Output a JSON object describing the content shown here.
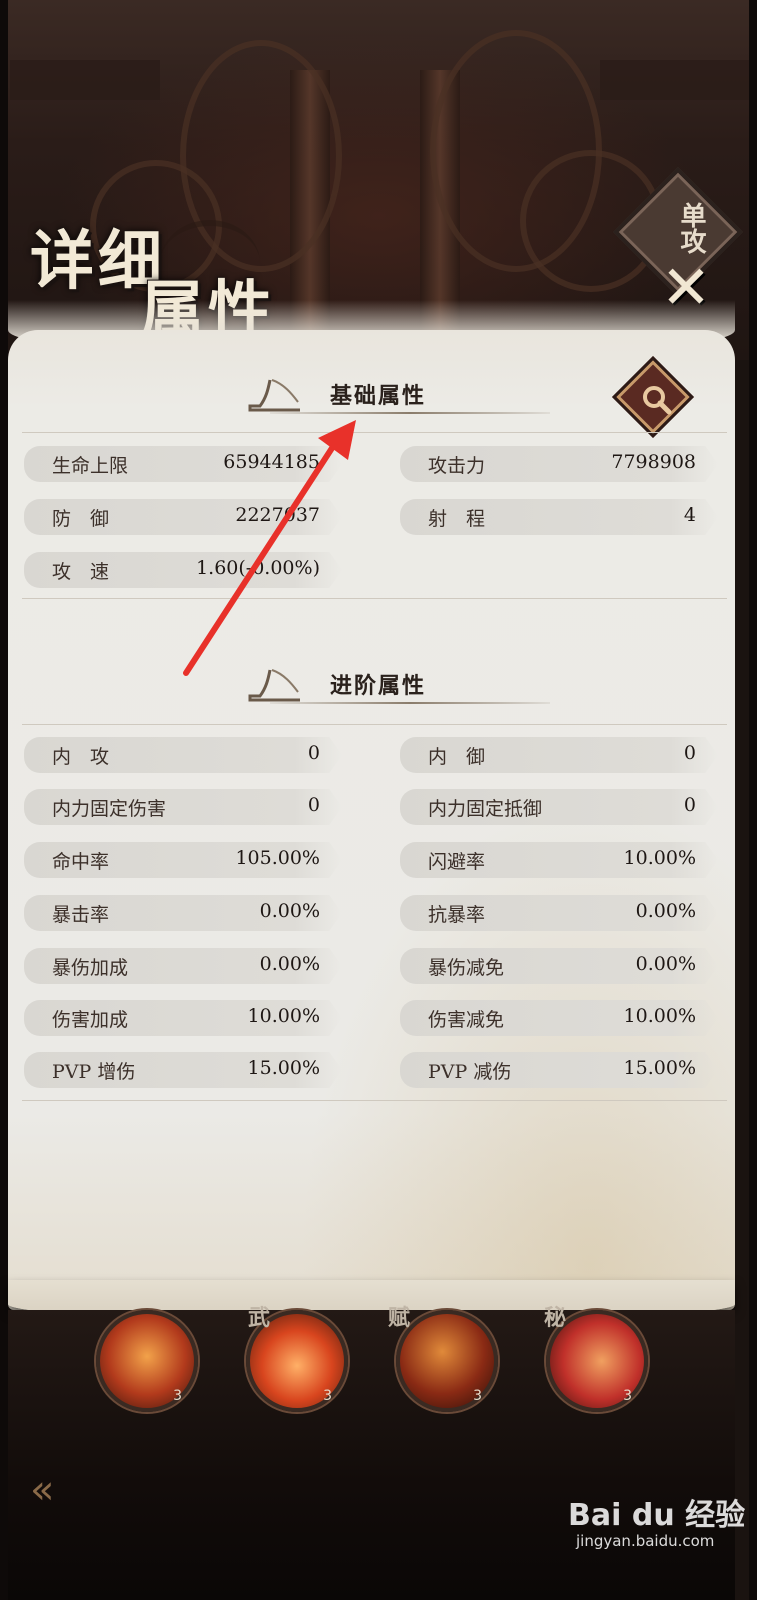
{
  "title": {
    "line1": "详细",
    "line2": "属性"
  },
  "mode_badge": "单攻",
  "close_icon": "close-icon",
  "basic_section": {
    "title": "基础属性",
    "stats": [
      {
        "label": "生命上限",
        "value": "65944185"
      },
      {
        "label": "攻击力",
        "value": "7798908"
      },
      {
        "label": "防　御",
        "value": "2227037"
      },
      {
        "label": "射　程",
        "value": "4"
      },
      {
        "label": "攻　速",
        "value": "1.60(-0.00%)"
      }
    ]
  },
  "advanced_section": {
    "title": "进阶属性",
    "stats": [
      {
        "label": "内　攻",
        "value": "0"
      },
      {
        "label": "内　御",
        "value": "0"
      },
      {
        "label": "内力固定伤害",
        "value": "0"
      },
      {
        "label": "内力固定抵御",
        "value": "0"
      },
      {
        "label": "命中率",
        "value": "105.00%"
      },
      {
        "label": "闪避率",
        "value": "10.00%"
      },
      {
        "label": "暴击率",
        "value": "0.00%"
      },
      {
        "label": "抗暴率",
        "value": "0.00%"
      },
      {
        "label": "暴伤加成",
        "value": "0.00%"
      },
      {
        "label": "暴伤减免",
        "value": "0.00%"
      },
      {
        "label": "伤害加成",
        "value": "10.00%"
      },
      {
        "label": "伤害减免",
        "value": "10.00%"
      },
      {
        "label": "PVP 增伤",
        "value": "15.00%"
      },
      {
        "label": "PVP 减伤",
        "value": "15.00%"
      }
    ]
  },
  "skills": [
    {
      "tag": "",
      "level": "3"
    },
    {
      "tag": "武",
      "level": "3"
    },
    {
      "tag": "赋",
      "level": "3"
    },
    {
      "tag": "秘",
      "level": "3"
    }
  ],
  "watermark": {
    "brand": "Bai du 经验",
    "site": "jingyan.baidu.com"
  },
  "colors": {
    "accent_red": "#e8312a",
    "parchment": "#ebeae6",
    "pill": "#dcdad5",
    "dark_bg": "#1a1310"
  }
}
